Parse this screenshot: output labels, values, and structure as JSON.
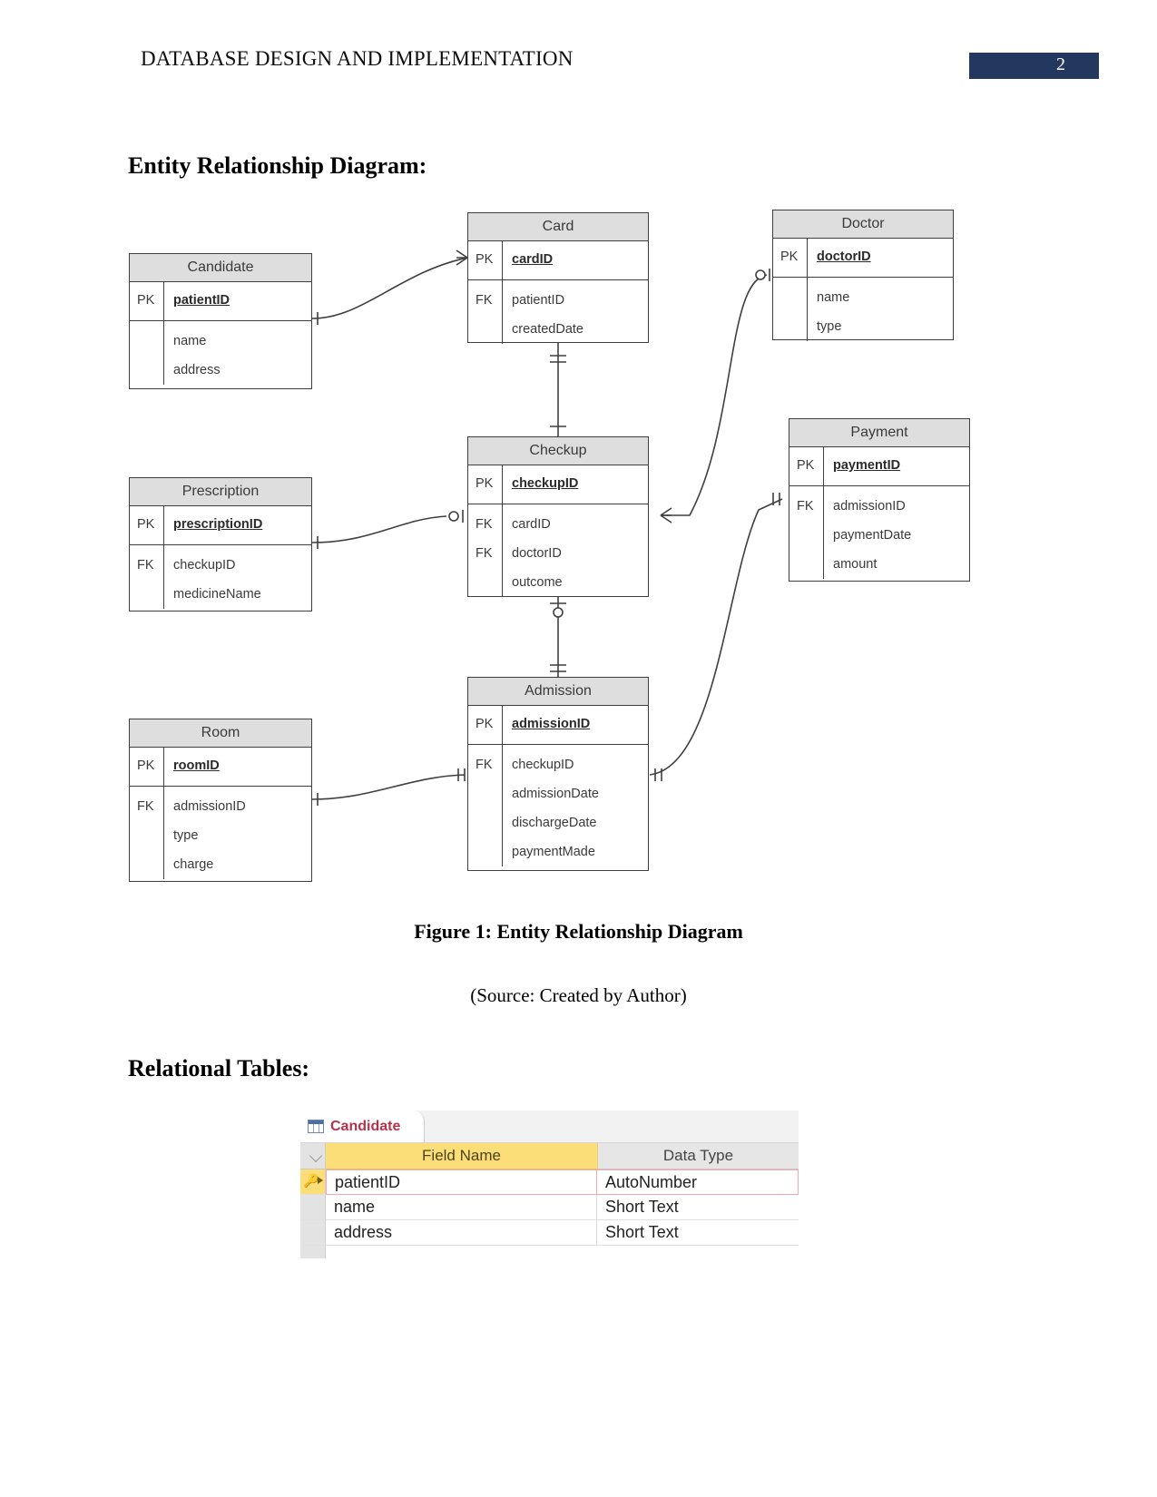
{
  "header": {
    "title": "DATABASE DESIGN AND IMPLEMENTATION",
    "page_number": "2",
    "badge_color": "#22385e"
  },
  "headings": {
    "erd": "Entity Relationship Diagram:",
    "relational": "Relational Tables:"
  },
  "figure": {
    "caption": "Figure 1: Entity Relationship Diagram",
    "source": "(Source: Created by Author)"
  },
  "erd": {
    "entities": [
      {
        "name": "Candidate",
        "pk": {
          "key": "PK",
          "field": "patientID"
        },
        "fields": [
          {
            "key": "",
            "field": "name"
          },
          {
            "key": "",
            "field": "address"
          }
        ]
      },
      {
        "name": "Card",
        "pk": {
          "key": "PK",
          "field": "cardID"
        },
        "fields": [
          {
            "key": "FK",
            "field": "patientID"
          },
          {
            "key": "",
            "field": "createdDate"
          }
        ]
      },
      {
        "name": "Doctor",
        "pk": {
          "key": "PK",
          "field": "doctorID"
        },
        "fields": [
          {
            "key": "",
            "field": "name"
          },
          {
            "key": "",
            "field": "type"
          }
        ]
      },
      {
        "name": "Prescription",
        "pk": {
          "key": "PK",
          "field": "prescriptionID"
        },
        "fields": [
          {
            "key": "FK",
            "field": "checkupID"
          },
          {
            "key": "",
            "field": "medicineName"
          }
        ]
      },
      {
        "name": "Checkup",
        "pk": {
          "key": "PK",
          "field": "checkupID"
        },
        "fields": [
          {
            "key": "FK",
            "field": "cardID"
          },
          {
            "key": "FK",
            "field": "doctorID"
          },
          {
            "key": "",
            "field": "outcome"
          }
        ]
      },
      {
        "name": "Payment",
        "pk": {
          "key": "PK",
          "field": "paymentID"
        },
        "fields": [
          {
            "key": "FK",
            "field": "admissionID"
          },
          {
            "key": "",
            "field": "paymentDate"
          },
          {
            "key": "",
            "field": "amount"
          }
        ]
      },
      {
        "name": "Room",
        "pk": {
          "key": "PK",
          "field": "roomID"
        },
        "fields": [
          {
            "key": "FK",
            "field": "admissionID"
          },
          {
            "key": "",
            "field": "type"
          },
          {
            "key": "",
            "field": "charge"
          }
        ]
      },
      {
        "name": "Admission",
        "pk": {
          "key": "PK",
          "field": "admissionID"
        },
        "fields": [
          {
            "key": "FK",
            "field": "checkupID"
          },
          {
            "key": "",
            "field": "admissionDate"
          },
          {
            "key": "",
            "field": "dischargeDate"
          },
          {
            "key": "",
            "field": "paymentMade"
          }
        ]
      }
    ],
    "relationships": [
      {
        "from": "Candidate",
        "to": "Card"
      },
      {
        "from": "Card",
        "to": "Checkup"
      },
      {
        "from": "Doctor",
        "to": "Checkup"
      },
      {
        "from": "Prescription",
        "to": "Checkup"
      },
      {
        "from": "Checkup",
        "to": "Admission"
      },
      {
        "from": "Admission",
        "to": "Payment"
      },
      {
        "from": "Room",
        "to": "Admission"
      }
    ]
  },
  "access": {
    "tab_label": "Candidate",
    "columns": {
      "field_name": "Field Name",
      "data_type": "Data Type"
    },
    "rows": [
      {
        "field": "patientID",
        "type": "AutoNumber",
        "primary_key": true
      },
      {
        "field": "name",
        "type": "Short Text",
        "primary_key": false
      },
      {
        "field": "address",
        "type": "Short Text",
        "primary_key": false
      }
    ]
  }
}
